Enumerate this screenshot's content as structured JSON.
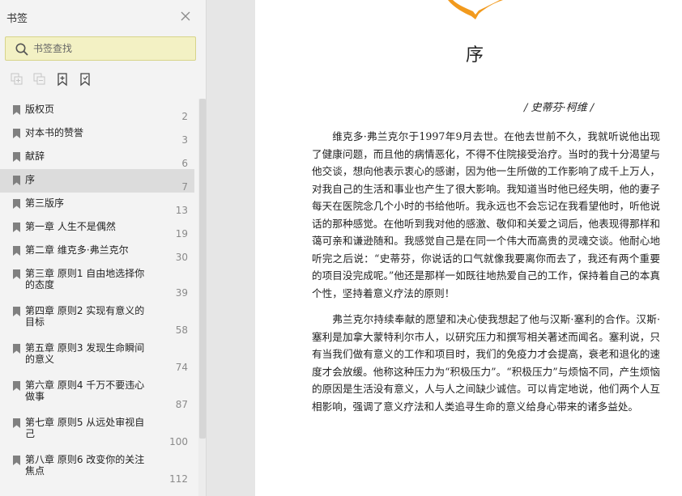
{
  "sidebar": {
    "title": "书签",
    "search": {
      "placeholder": "书签查找"
    },
    "bookmarks": [
      {
        "label": "版权页",
        "page": "2"
      },
      {
        "label": "对本书的赞誉",
        "page": "3"
      },
      {
        "label": "献辞",
        "page": "6"
      },
      {
        "label": "序",
        "page": "7",
        "active": true
      },
      {
        "label": "第三版序",
        "page": "13"
      },
      {
        "label": "第一章 人生不是偶然",
        "page": "19"
      },
      {
        "label": "第二章 维克多·弗兰克尔",
        "page": "30"
      },
      {
        "label": "第三章 原则1 自由地选择你的态度",
        "page": "39"
      },
      {
        "label": "第四章 原则2 实现有意义的目标",
        "page": "58"
      },
      {
        "label": "第五章 原则3 发现生命瞬间的意义",
        "page": "74"
      },
      {
        "label": "第六章 原则4 千万不要违心做事",
        "page": "87"
      },
      {
        "label": "第七章 原则5 从远处审视自己",
        "page": "100"
      },
      {
        "label": "第八章 原则6 改变你的关注焦点",
        "page": "112"
      }
    ]
  },
  "document": {
    "chapter_title": "序",
    "author_line": "/ 史蒂芬·柯维 /",
    "paragraphs": [
      "维克多·弗兰克尔于1997年9月去世。在他去世前不久，我就听说他出现了健康问题，而且他的病情恶化，不得不住院接受治疗。当时的我十分渴望与他交谈，想向他表示衷心的感谢，因为他一生所做的工作影响了成千上万人，对我自己的生活和事业也产生了很大影响。我知道当时他已经失明，他的妻子每天在医院念几个小时的书给他听。我永远也不会忘记在我看望他时，听他说话的那种感觉。在他听到我对他的感激、敬仰和关爱之词后，他表现得那样和蔼可亲和谦逊随和。我感觉自己是在同一个伟大而高贵的灵魂交谈。他耐心地听完之后说：“史蒂芬，你说话的口气就像我要离你而去了，我还有两个重要的项目没完成呢。”他还是那样一如既往地热爱自己的工作，保持着自己的本真个性，坚持着意义疗法的原则！",
      "弗兰克尔持续奉献的愿望和决心使我想起了他与汉斯·塞利的合作。汉斯·塞利是加拿大蒙特利尔市人，以研究压力和撰写相关著述而闻名。塞利说，只有当我们做有意义的工作和项目时，我们的免疫力才会提高，衰老和退化的速度才会放缓。他称这种压力为“积极压力”。“积极压力”与烦恼不同，产生烦恼的原因是生活没有意义，人与人之间缺少诚信。可以肯定地说，他们两个人互相影响，强调了意义疗法和人类追寻生命的意义给身心带来的诸多益处。"
    ]
  },
  "colors": {
    "search_bg": "#f3f1c4",
    "active_row": "#dcdcdc",
    "deco_orange": "#f29a1d"
  }
}
